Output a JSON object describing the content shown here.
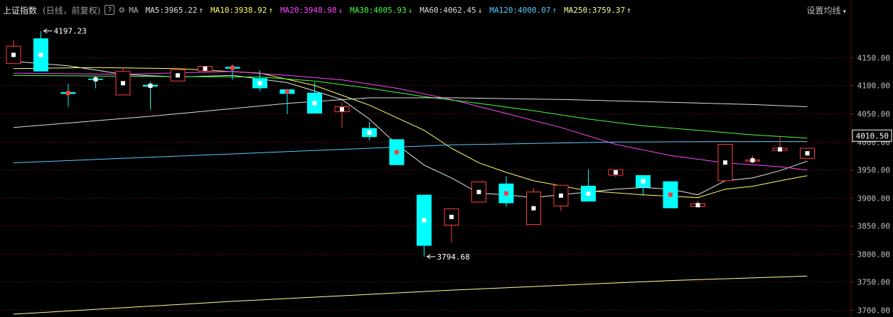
{
  "header": {
    "title": "上证指数",
    "subtitle": "(日线，前复权)",
    "help_label": "?",
    "ma_label": "MA",
    "ma_items": [
      {
        "text": "MA5:3965.22",
        "arrow": "↑",
        "color": "#e0e0e0"
      },
      {
        "text": "MA10:3938.92",
        "arrow": "↑",
        "color": "#ffff66"
      },
      {
        "text": "MA20:3948.98",
        "arrow": "↓",
        "color": "#ff44ff"
      },
      {
        "text": "MA30:4005.93",
        "arrow": "↓",
        "color": "#44ff44"
      },
      {
        "text": "MA60:4062.45",
        "arrow": "↓",
        "color": "#dddddd"
      },
      {
        "text": "MA120:4000.07",
        "arrow": "↑",
        "color": "#55ccff"
      },
      {
        "text": "MA250:3759.37",
        "arrow": "↑",
        "color": "#ffff99"
      }
    ],
    "settings_label": "设置均线",
    "settings_caret": "▾"
  },
  "colors": {
    "up": "#ff3c3c",
    "down": "#00ffff",
    "grid": "#8a1f1f",
    "axis_text": "#c0c0c0",
    "current_box": "#ffffff"
  },
  "chart_data": {
    "type": "candlestick",
    "y_ticks": [
      4150.0,
      4100.0,
      4050.0,
      4000.0,
      3950.0,
      3900.0,
      3850.0,
      3800.0,
      3750.0,
      3700.0
    ],
    "ylim": [
      3687,
      4217
    ],
    "current_price": "4010.50",
    "high_annotation": {
      "index": 1,
      "label": "4197.23"
    },
    "low_annotation": {
      "index": 15,
      "label": "3794.68"
    },
    "candles": [
      {
        "o": 4139,
        "h": 4181,
        "l": 4139,
        "c": 4170
      },
      {
        "o": 4184,
        "h": 4197,
        "l": 4125,
        "c": 4125
      },
      {
        "o": 4088,
        "h": 4103,
        "l": 4062,
        "c": 4085
      },
      {
        "o": 4112,
        "h": 4117,
        "l": 4095,
        "c": 4110
      },
      {
        "o": 4083,
        "h": 4131,
        "l": 4083,
        "c": 4125
      },
      {
        "o": 4101,
        "h": 4106,
        "l": 4057,
        "c": 4098
      },
      {
        "o": 4108,
        "h": 4128,
        "l": 4108,
        "c": 4128
      },
      {
        "o": 4126,
        "h": 4134,
        "l": 4122,
        "c": 4134
      },
      {
        "o": 4133,
        "h": 4137,
        "l": 4110,
        "c": 4130
      },
      {
        "o": 4113,
        "h": 4127,
        "l": 4090,
        "c": 4095
      },
      {
        "o": 4093,
        "h": 4094,
        "l": 4049,
        "c": 4085
      },
      {
        "o": 4087,
        "h": 4105,
        "l": 4050,
        "c": 4050
      },
      {
        "o": 4053,
        "h": 4070,
        "l": 4024,
        "c": 4062
      },
      {
        "o": 4024,
        "h": 4035,
        "l": 4002,
        "c": 4008
      },
      {
        "o": 4004,
        "h": 4004,
        "l": 3958,
        "c": 3958
      },
      {
        "o": 3905,
        "h": 3905,
        "l": 3794.68,
        "c": 3814
      },
      {
        "o": 3851,
        "h": 3880,
        "l": 3820,
        "c": 3880
      },
      {
        "o": 3892,
        "h": 3928,
        "l": 3892,
        "c": 3928
      },
      {
        "o": 3925,
        "h": 3938,
        "l": 3883,
        "c": 3890
      },
      {
        "o": 3852,
        "h": 3917,
        "l": 3852,
        "c": 3910
      },
      {
        "o": 3885,
        "h": 3923,
        "l": 3876,
        "c": 3922
      },
      {
        "o": 3921,
        "h": 3950,
        "l": 3893,
        "c": 3893
      },
      {
        "o": 3940,
        "h": 3950,
        "l": 3936,
        "c": 3950
      },
      {
        "o": 3940,
        "h": 3940,
        "l": 3903,
        "c": 3918
      },
      {
        "o": 3929,
        "h": 3929,
        "l": 3881,
        "c": 3881
      },
      {
        "o": 3884,
        "h": 3894,
        "l": 3884,
        "c": 3889
      },
      {
        "o": 3930,
        "h": 3995,
        "l": 3930,
        "c": 3995
      },
      {
        "o": 3966,
        "h": 3975,
        "l": 3961,
        "c": 3967
      },
      {
        "o": 3984,
        "h": 4010,
        "l": 3984,
        "c": 3988
      },
      {
        "o": 3970,
        "h": 3988,
        "l": 3970,
        "c": 3988
      }
    ],
    "ma_lines": [
      {
        "name": "MA5",
        "color": "#e8e8e8",
        "points": [
          [
            0,
            4143
          ],
          [
            2,
            4135
          ],
          [
            4,
            4120
          ],
          [
            6,
            4115
          ],
          [
            8,
            4118
          ],
          [
            10,
            4105
          ],
          [
            11,
            4090
          ],
          [
            12,
            4075
          ],
          [
            13,
            4040
          ],
          [
            14,
            3995
          ],
          [
            15,
            3958
          ],
          [
            16,
            3935
          ],
          [
            17,
            3908
          ],
          [
            18,
            3905
          ],
          [
            19,
            3900
          ],
          [
            21,
            3910
          ],
          [
            22,
            3915
          ],
          [
            23,
            3918
          ],
          [
            24,
            3915
          ],
          [
            25,
            3905
          ],
          [
            26,
            3930
          ],
          [
            27,
            3935
          ],
          [
            28,
            3948
          ],
          [
            29,
            3965
          ]
        ]
      },
      {
        "name": "MA10",
        "color": "#ffff66",
        "points": [
          [
            0,
            4130
          ],
          [
            3,
            4132
          ],
          [
            6,
            4130
          ],
          [
            9,
            4122
          ],
          [
            11,
            4100
          ],
          [
            13,
            4065
          ],
          [
            15,
            4020
          ],
          [
            16,
            3988
          ],
          [
            17,
            3962
          ],
          [
            18,
            3945
          ],
          [
            19,
            3930
          ],
          [
            21,
            3912
          ],
          [
            23,
            3905
          ],
          [
            25,
            3900
          ],
          [
            26,
            3915
          ],
          [
            27,
            3920
          ],
          [
            28,
            3930
          ],
          [
            29,
            3939
          ]
        ]
      },
      {
        "name": "MA20",
        "color": "#ff44ff",
        "points": [
          [
            0,
            4122
          ],
          [
            4,
            4120
          ],
          [
            8,
            4125
          ],
          [
            10,
            4118
          ],
          [
            12,
            4110
          ],
          [
            14,
            4095
          ],
          [
            16,
            4075
          ],
          [
            18,
            4050
          ],
          [
            20,
            4025
          ],
          [
            22,
            3995
          ],
          [
            24,
            3975
          ],
          [
            26,
            3962
          ],
          [
            28,
            3955
          ],
          [
            29,
            3949
          ]
        ]
      },
      {
        "name": "MA30",
        "color": "#44ff44",
        "points": [
          [
            0,
            4118
          ],
          [
            5,
            4116
          ],
          [
            9,
            4115
          ],
          [
            11,
            4108
          ],
          [
            13,
            4095
          ],
          [
            15,
            4080
          ],
          [
            17,
            4068
          ],
          [
            19,
            4055
          ],
          [
            21,
            4040
          ],
          [
            23,
            4028
          ],
          [
            25,
            4020
          ],
          [
            27,
            4012
          ],
          [
            29,
            4006
          ]
        ]
      },
      {
        "name": "MA60",
        "color": "#dddddd",
        "points": [
          [
            0,
            4025
          ],
          [
            5,
            4045
          ],
          [
            10,
            4068
          ],
          [
            13,
            4078
          ],
          [
            16,
            4078
          ],
          [
            20,
            4075
          ],
          [
            24,
            4070
          ],
          [
            27,
            4066
          ],
          [
            29,
            4062
          ]
        ]
      },
      {
        "name": "MA120",
        "color": "#55ccff",
        "points": [
          [
            0,
            3962
          ],
          [
            10,
            3982
          ],
          [
            16,
            3994
          ],
          [
            22,
            3999
          ],
          [
            26,
            4000
          ],
          [
            29,
            4000
          ]
        ]
      },
      {
        "name": "MA250",
        "color": "#ffff99",
        "points": [
          [
            0,
            3692
          ],
          [
            8,
            3715
          ],
          [
            16,
            3735
          ],
          [
            24,
            3752
          ],
          [
            29,
            3760
          ]
        ]
      }
    ]
  }
}
